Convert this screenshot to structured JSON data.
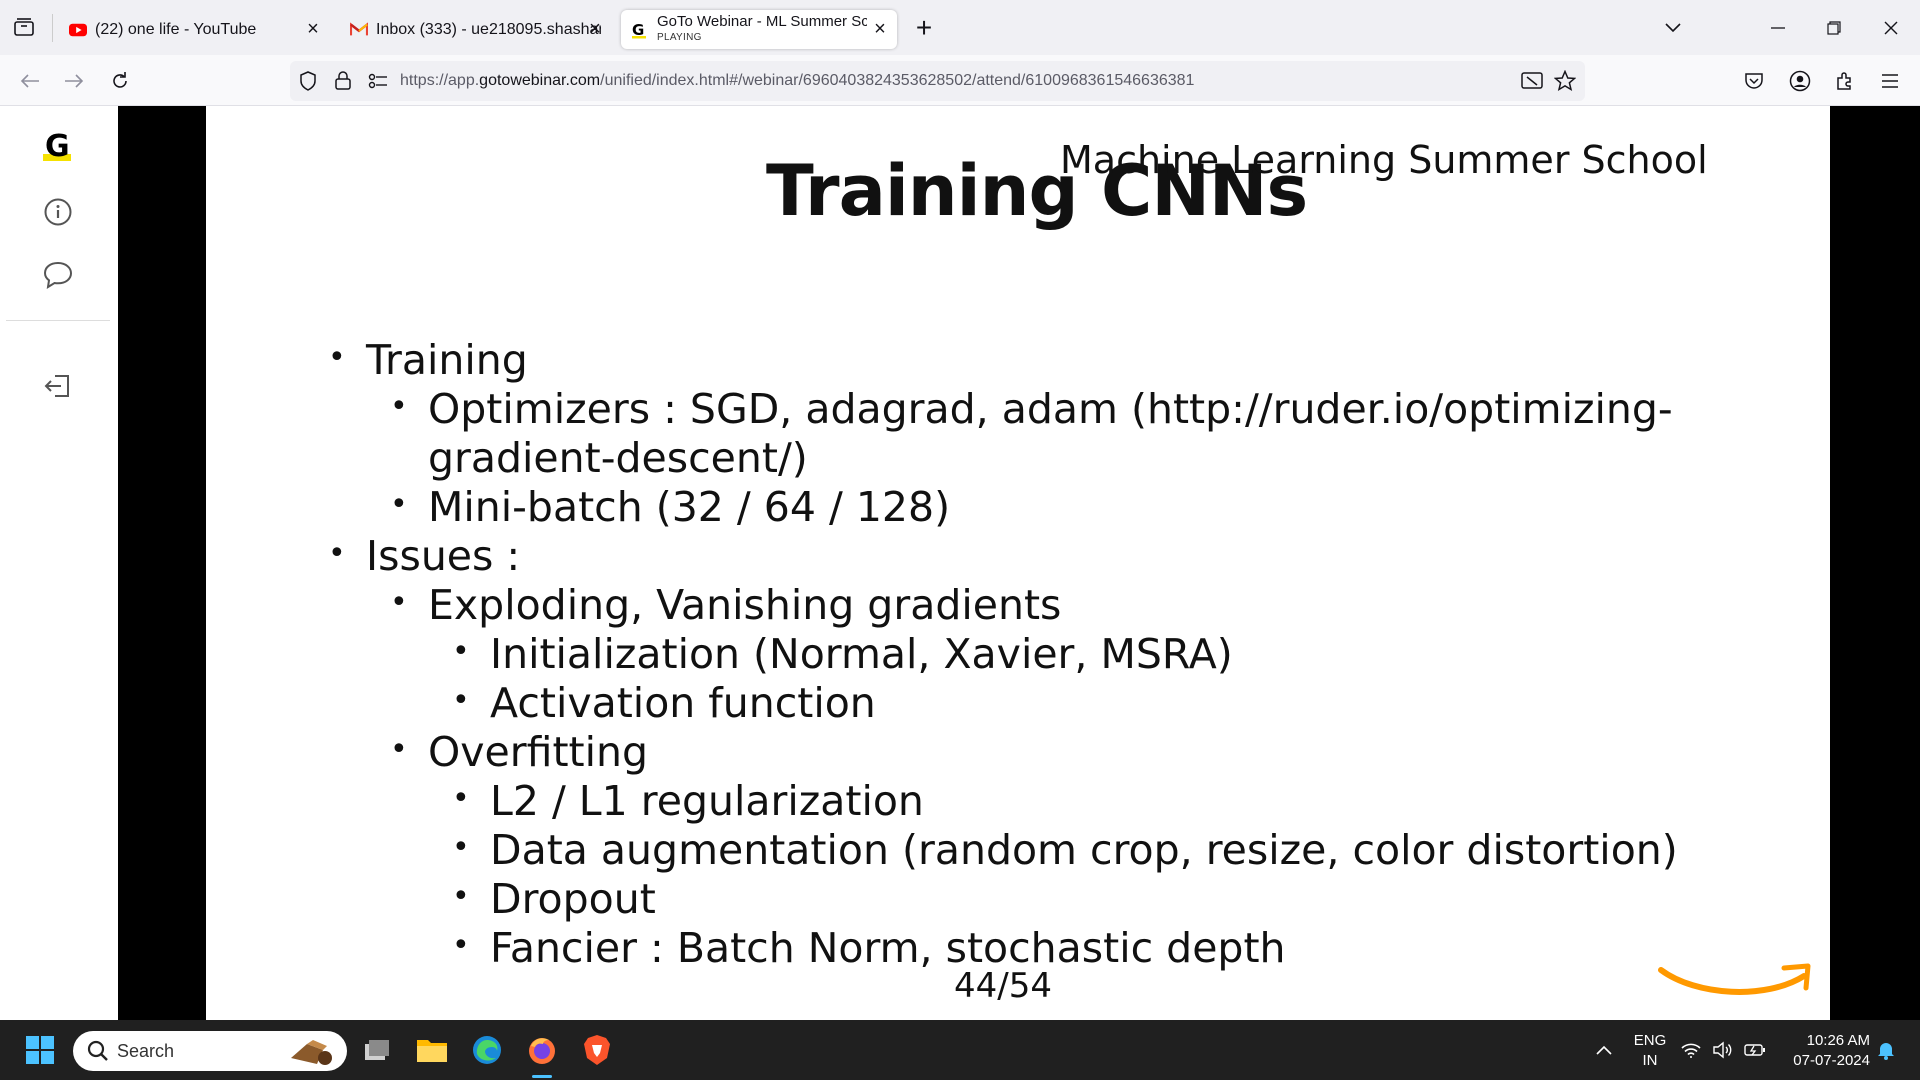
{
  "browser": {
    "tabs": [
      {
        "title": "(22) one life - YouTube",
        "icon": "youtube-icon"
      },
      {
        "title": "Inbox (333) - ue218095.shashank",
        "icon": "gmail-icon"
      },
      {
        "title": "GoTo Webinar - ML Summer Sc",
        "subtitle": "PLAYING",
        "icon": "goto-icon",
        "active": true
      }
    ],
    "url_prefix": "https://app.",
    "url_host": "gotowebinar.com",
    "url_path": "/unified/index.html#/webinar/6960403824353628502/attend/6100968361546636381"
  },
  "rail": {
    "logo": "G"
  },
  "slide": {
    "title": "Training CNNs",
    "school": "Machine Learning Summer School",
    "bullets": [
      {
        "level": 1,
        "text": "Training"
      },
      {
        "level": 2,
        "text": "Optimizers : SGD, adagrad, adam (http://ruder.io/optimizing-"
      },
      {
        "level": 2,
        "text": "gradient-descent/)",
        "continuation": true
      },
      {
        "level": 2,
        "text": "Mini-batch (32 / 64 / 128)"
      },
      {
        "level": 1,
        "text": "Issues :"
      },
      {
        "level": 2,
        "text": "Exploding, Vanishing gradients"
      },
      {
        "level": 3,
        "text": "Initialization (Normal, Xavier, MSRA)"
      },
      {
        "level": 3,
        "text": "Activation function"
      },
      {
        "level": 2,
        "text": "Overfitting"
      },
      {
        "level": 3,
        "text": "L2 / L1 regularization"
      },
      {
        "level": 3,
        "text": "Data augmentation (random crop, resize, color distortion)"
      },
      {
        "level": 3,
        "text": "Dropout"
      },
      {
        "level": 3,
        "text": "Fancier : Batch Norm, stochastic depth"
      }
    ],
    "page": "44/54"
  },
  "taskbar": {
    "search_placeholder": "Search",
    "lang_top": "ENG",
    "lang_bottom": "IN",
    "time": "10:26 AM",
    "date": "07-07-2024"
  },
  "colors": {
    "accent_yellow": "#f5e100",
    "smile_orange": "#ff9900",
    "taskbar": "#202020"
  }
}
